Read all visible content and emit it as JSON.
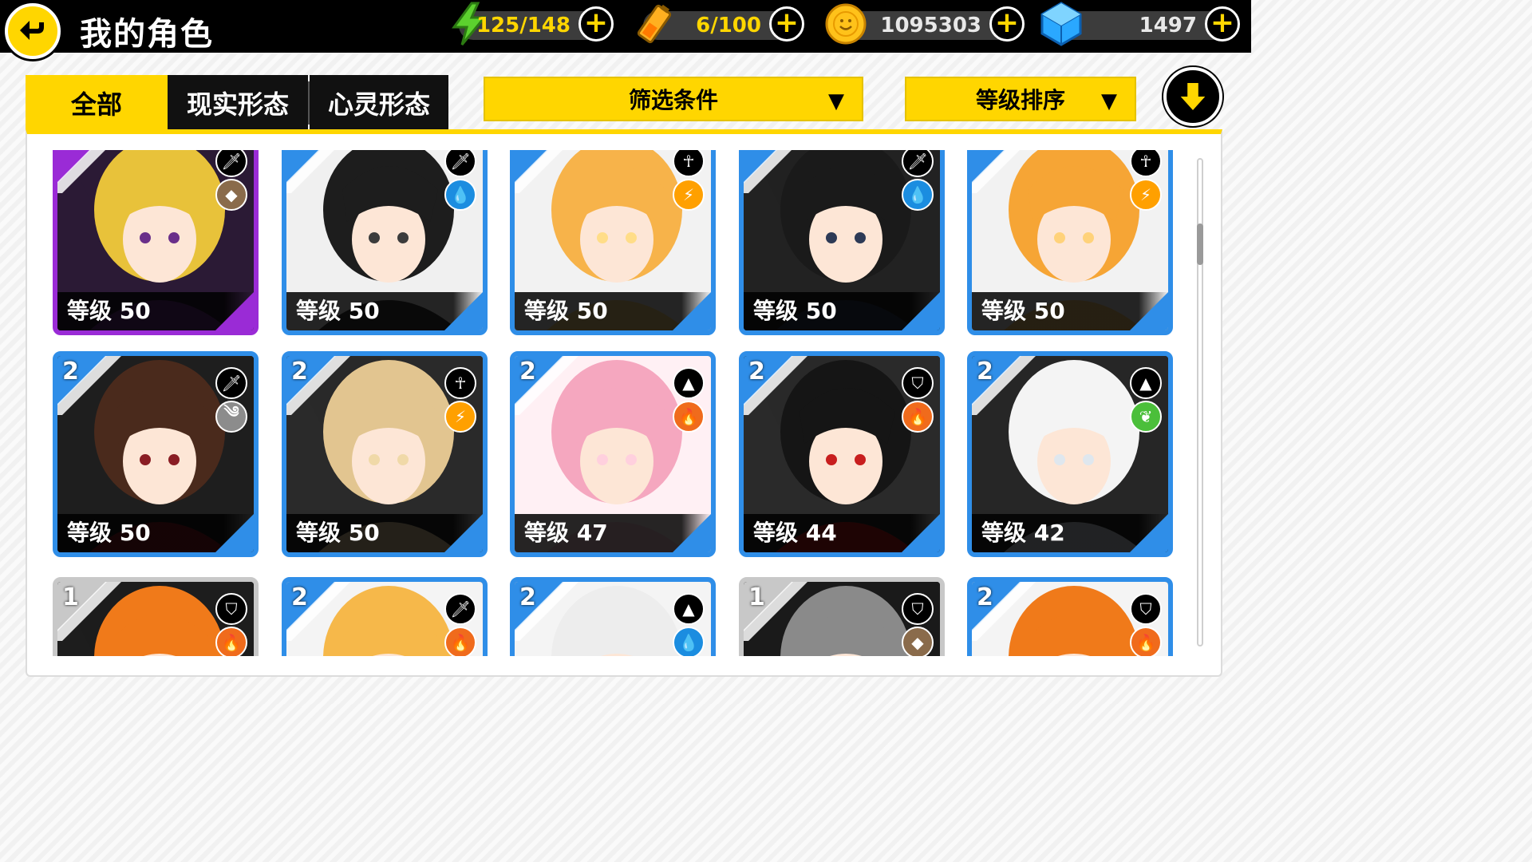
{
  "header": {
    "title": "我的角色",
    "resources": [
      {
        "icon": "lightning-energy-icon",
        "current": "125",
        "separator": "/",
        "max": "148"
      },
      {
        "icon": "battery-icon",
        "current": "6",
        "separator": "/",
        "max": "100"
      },
      {
        "icon": "gold-coin-icon",
        "value": "1095303"
      },
      {
        "icon": "blue-diamond-icon",
        "value": "1497"
      }
    ],
    "plus_label": "+"
  },
  "tabs": [
    {
      "label": "全部",
      "active": true
    },
    {
      "label": "现实形态",
      "active": false
    },
    {
      "label": "心灵形态",
      "active": false
    }
  ],
  "filters": {
    "filter_label": "筛选条件",
    "sort_label": "等级排序",
    "arrow": "▼"
  },
  "colors": {
    "accent_yellow": "#ffd600",
    "card_blue": "#2f8ee8",
    "card_purple": "#9a2bd6",
    "card_silver": "#c8c8c8"
  },
  "cards": [
    {
      "stars": "",
      "level": "等级 50",
      "frame": "purple",
      "role": "sword-icon",
      "element": "earth-icon"
    },
    {
      "stars": "",
      "level": "等级 50",
      "frame": "blue",
      "role": "sword-icon",
      "element": "water-icon"
    },
    {
      "stars": "",
      "level": "等级 50",
      "frame": "blue",
      "role": "ankh-icon",
      "element": "thunder-icon"
    },
    {
      "stars": "",
      "level": "等级 50",
      "frame": "blue",
      "role": "sword-icon",
      "element": "water-icon"
    },
    {
      "stars": "",
      "level": "等级 50",
      "frame": "blue",
      "role": "ankh-icon",
      "element": "thunder-icon"
    },
    {
      "stars": "2",
      "level": "等级 50",
      "frame": "blue",
      "role": "sword-icon",
      "element": "wind-icon"
    },
    {
      "stars": "2",
      "level": "等级 50",
      "frame": "blue",
      "role": "ankh-icon",
      "element": "thunder-icon"
    },
    {
      "stars": "2",
      "level": "等级 47",
      "frame": "blue",
      "role": "triforce-icon",
      "element": "fire-icon"
    },
    {
      "stars": "2",
      "level": "等级 44",
      "frame": "blue",
      "role": "shield-icon",
      "element": "fire-icon"
    },
    {
      "stars": "2",
      "level": "等级 42",
      "frame": "blue",
      "role": "triforce-icon",
      "element": "leaf-icon"
    },
    {
      "stars": "1",
      "level": "",
      "frame": "silver",
      "role": "shield-icon",
      "element": "fire-icon"
    },
    {
      "stars": "2",
      "level": "",
      "frame": "blue",
      "role": "sword-icon",
      "element": "fire-icon"
    },
    {
      "stars": "2",
      "level": "",
      "frame": "blue",
      "role": "triforce-icon",
      "element": "water-icon"
    },
    {
      "stars": "1",
      "level": "",
      "frame": "silver",
      "role": "shield-icon",
      "element": "earth-icon"
    },
    {
      "stars": "2",
      "level": "",
      "frame": "blue",
      "role": "shield-icon",
      "element": "fire-icon"
    }
  ]
}
